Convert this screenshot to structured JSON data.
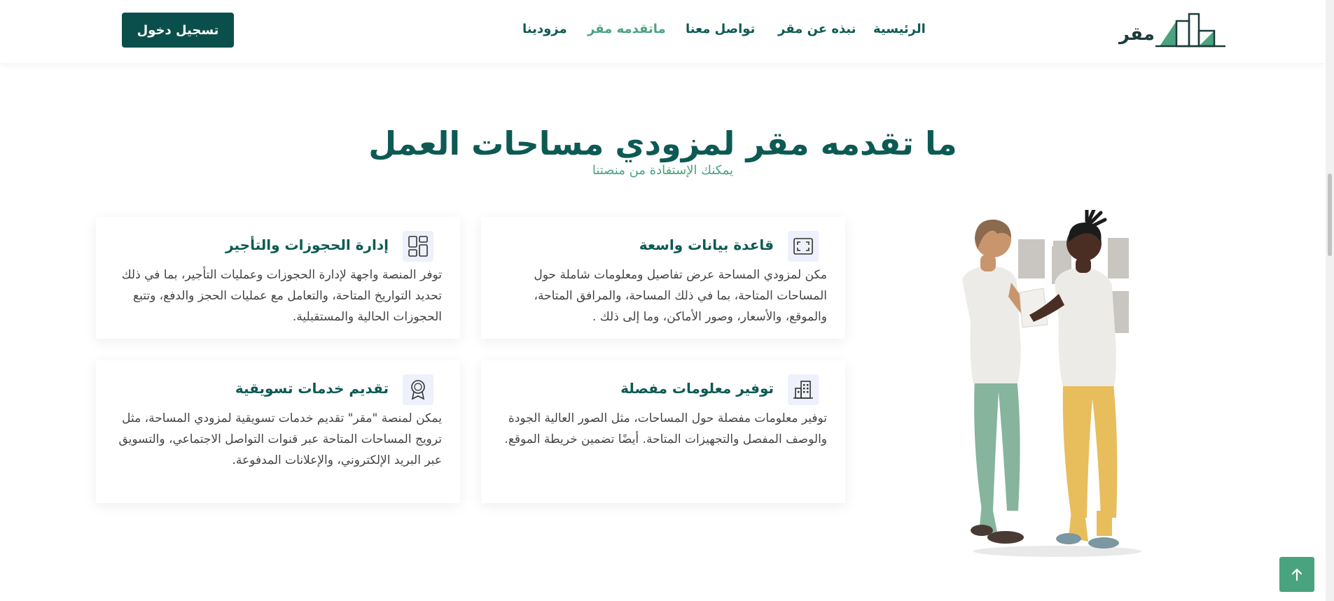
{
  "header": {
    "logo_text": "مقر",
    "nav": [
      {
        "label": "الرئيسية"
      },
      {
        "label": "نبذه عن مقر"
      },
      {
        "label": "تواصل معنا"
      },
      {
        "label": "ماتقدمه مقر"
      },
      {
        "label": "مزودينا"
      }
    ],
    "login_label": "تسجيل دخول"
  },
  "section": {
    "title": "ما تقدمه مقر لمزودي مساحات العمل",
    "subtitle": "يمكنك الإستفادة من منصتنا"
  },
  "cards": [
    {
      "icon": "expand-icon",
      "title": "قاعدة بيانات واسعة",
      "body": "مكن لمزودي المساحة عرض تفاصيل ومعلومات شاملة حول المساحات المتاحة، بما في ذلك المساحة، والمرافق المتاحة، والموقع، والأسعار، وصور الأماكن، وما إلى ذلك ."
    },
    {
      "icon": "dashboard-icon",
      "title": "إدارة الحجوزات والتأجير",
      "body": "توفر المنصة واجهة لإدارة الحجوزات وعمليات التأجير، بما في ذلك تحديد التواريخ المتاحة، والتعامل مع عمليات الحجز والدفع، وتتبع الحجوزات الحالية والمستقبلية."
    },
    {
      "icon": "building-icon",
      "title": "توفير معلومات مفصلة",
      "body": "توفير معلومات مفصلة حول المساحات، مثل الصور العالية الجودة والوصف المفصل والتجهيزات المتاحة. أيضًا تضمين خريطة الموقع."
    },
    {
      "icon": "award-icon",
      "title": "تقديم خدمات تسويقية",
      "body": "يمكن لمنصة \"مقر\" تقديم خدمات تسويقية لمزودي المساحة، مثل ترويج المساحات المتاحة عبر قنوات التواصل الاجتماعي، والتسويق عبر البريد الإلكتروني، والإعلانات المدفوعة."
    }
  ],
  "colors": {
    "primary": "#0d5a54",
    "accent": "#4aa37f",
    "button": "#0b4f4c",
    "icon_bg": "#eef0fb"
  }
}
